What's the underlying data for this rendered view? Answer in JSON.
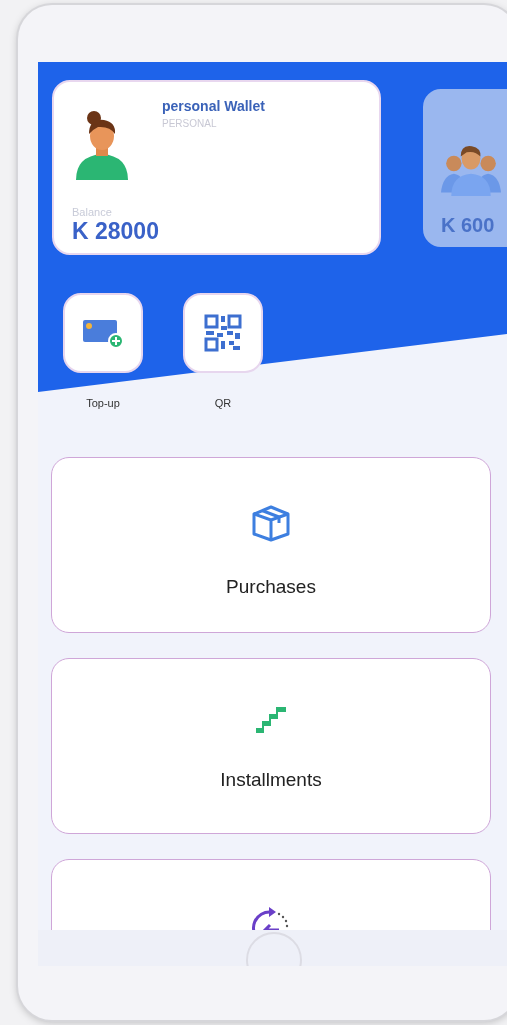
{
  "wallets": [
    {
      "name": "personal Wallet",
      "type": "PERSONAL",
      "balance_label": "Balance",
      "balance": "K 28000",
      "selected": true
    },
    {
      "balance": "K 600",
      "selected": false
    }
  ],
  "actions": [
    {
      "kind": "topup",
      "label": "Top-up"
    },
    {
      "kind": "qr",
      "label": "QR"
    }
  ],
  "menu": [
    {
      "kind": "box",
      "label": "Purchases"
    },
    {
      "kind": "stairs",
      "label": "Installments"
    },
    {
      "kind": "refund"
    }
  ]
}
